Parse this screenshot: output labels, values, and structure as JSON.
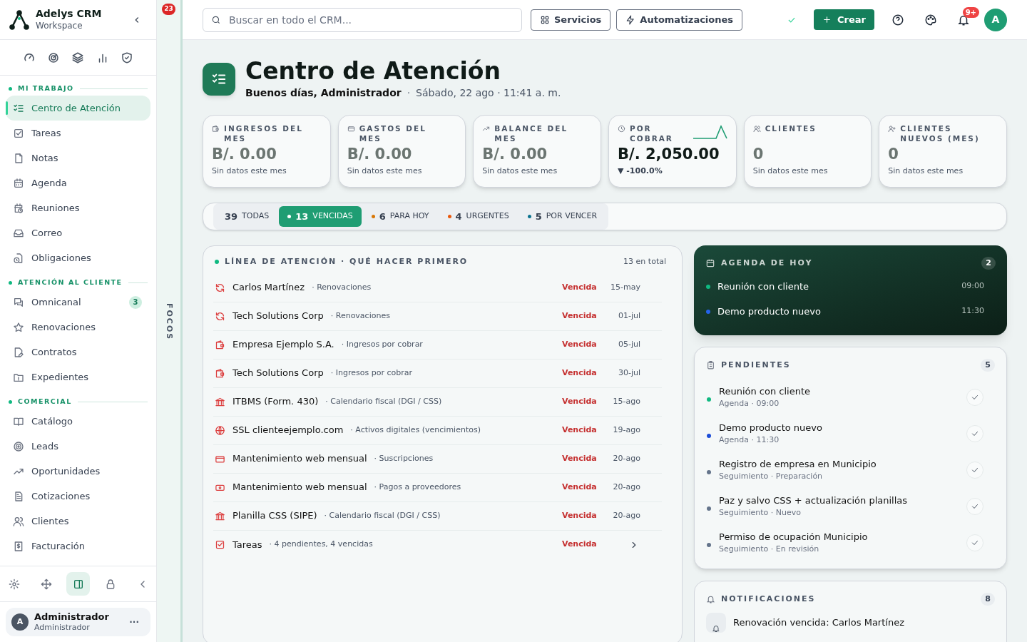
{
  "sidebar": {
    "brand": "Adelys CRM",
    "workspace": "Workspace",
    "sections": [
      {
        "title": "MI TRABAJO",
        "items": [
          {
            "label": "Centro de Atención",
            "selected": true
          },
          {
            "label": "Tareas",
            "selected": false
          },
          {
            "label": "Notas",
            "selected": false
          },
          {
            "label": "Agenda",
            "selected": false
          },
          {
            "label": "Reuniones",
            "selected": false
          },
          {
            "label": "Correo",
            "selected": false
          },
          {
            "label": "Obligaciones",
            "selected": false
          }
        ]
      },
      {
        "title": "ATENCIÓN AL CLIENTE",
        "items": [
          {
            "label": "Omnicanal",
            "selected": false,
            "badge": "3"
          },
          {
            "label": "Renovaciones",
            "selected": false
          },
          {
            "label": "Contratos",
            "selected": false
          },
          {
            "label": "Expedientes",
            "selected": false
          }
        ]
      },
      {
        "title": "COMERCIAL",
        "items": [
          {
            "label": "Catálogo",
            "selected": false
          },
          {
            "label": "Leads",
            "selected": false
          },
          {
            "label": "Oportunidades",
            "selected": false
          },
          {
            "label": "Cotizaciones",
            "selected": false
          },
          {
            "label": "Clientes",
            "selected": false
          },
          {
            "label": "Facturación",
            "selected": false
          }
        ]
      }
    ],
    "tools": [
      {
        "selected": false
      },
      {
        "selected": false
      },
      {
        "selected": true
      },
      {
        "selected": false
      },
      {
        "selected": false
      }
    ],
    "user": {
      "avatar": "A",
      "name": "Administrador",
      "role": "Administrador",
      "more": "···"
    }
  },
  "rail": {
    "badge": "23",
    "label": "FOCOS"
  },
  "topbar": {
    "search": {
      "placeholder": "Buscar en todo el CRM..."
    },
    "buttons": [
      "Servicios",
      "Automatizaciones"
    ],
    "create": "Crear",
    "notifications_badge": "9+",
    "avatar": "A"
  },
  "header": {
    "title": "Centro de Atención",
    "greeting": "Buenos días, Administrador",
    "separator": "·",
    "date": "Sábado, 22 ago · 11:41 a. m."
  },
  "stats": [
    {
      "label": "INGRESOS DEL MES",
      "value": "B/. 0.00",
      "note": "Sin datos este mes",
      "empty": true
    },
    {
      "label": "GASTOS DEL MES",
      "value": "B/. 0.00",
      "note": "Sin datos este mes",
      "empty": true
    },
    {
      "label": "BALANCE DEL MES",
      "value": "B/. 0.00",
      "note": "Sin datos este mes",
      "empty": true
    },
    {
      "label": "POR COBRAR",
      "value": "B/. 2,050.00",
      "trend": "▼ -100.0%",
      "empty": false,
      "sparkline": true
    },
    {
      "label": "CLIENTES",
      "value": "0",
      "note": "Sin datos este mes",
      "empty": true
    },
    {
      "label": "CLIENTES NUEVOS (MES)",
      "value": "0",
      "note": "Sin datos este mes",
      "empty": true
    }
  ],
  "filters": [
    {
      "count": "39",
      "label": "TODAS",
      "selected": false
    },
    {
      "count": "13",
      "label": "VENCIDAS",
      "selected": true,
      "color": "#ffffff"
    },
    {
      "count": "6",
      "label": "PARA HOY",
      "selected": false,
      "color": "#d97706"
    },
    {
      "count": "4",
      "label": "URGENTES",
      "selected": false,
      "color": "#ea580c"
    },
    {
      "count": "5",
      "label": "POR VENCER",
      "selected": false,
      "color": "#0e7490"
    }
  ],
  "focus": {
    "title": "LÍNEA DE ATENCIÓN · QUÉ HACER PRIMERO",
    "total": "13 en total",
    "rows": [
      {
        "kind": "item",
        "title": "Carlos Martínez",
        "category": "· Renovaciones",
        "status": "Vencida",
        "date": "15-may"
      },
      {
        "kind": "item",
        "title": "Tech Solutions Corp",
        "category": "· Renovaciones",
        "status": "Vencida",
        "date": "01-jul"
      },
      {
        "kind": "item",
        "title": "Empresa Ejemplo S.A.",
        "category": "· Ingresos por cobrar",
        "status": "Vencida",
        "date": "05-jul"
      },
      {
        "kind": "item",
        "title": "Tech Solutions Corp",
        "category": "· Ingresos por cobrar",
        "status": "Vencida",
        "date": "30-jul"
      },
      {
        "kind": "item",
        "title": "ITBMS (Form. 430)",
        "category": "· Calendario fiscal (DGI / CSS)",
        "status": "Vencida",
        "date": "15-ago"
      },
      {
        "kind": "item",
        "title": "SSL clienteejemplo.com",
        "category": "· Activos digitales (vencimientos)",
        "status": "Vencida",
        "date": "19-ago"
      },
      {
        "kind": "item",
        "title": "Mantenimiento web mensual",
        "category": "· Suscripciones",
        "status": "Vencida",
        "date": "20-ago"
      },
      {
        "kind": "item",
        "title": "Mantenimiento web mensual",
        "category": "· Pagos a proveedores",
        "status": "Vencida",
        "date": "20-ago"
      },
      {
        "kind": "item",
        "title": "Planilla CSS (SIPE)",
        "category": "· Calendario fiscal (DGI / CSS)",
        "status": "Vencida",
        "date": "20-ago"
      },
      {
        "kind": "group",
        "title": "Tareas",
        "category": "· 4 pendientes, 4 vencidas",
        "status": "Vencida"
      }
    ]
  },
  "agenda": {
    "title": "AGENDA DE HOY",
    "count": "2",
    "items": [
      {
        "title": "Reunión con cliente",
        "time": "09:00",
        "color": "#10b981"
      },
      {
        "title": "Demo producto nuevo",
        "time": "11:30",
        "color": "#2563eb"
      }
    ]
  },
  "pending": {
    "title": "PENDIENTES",
    "count": "5",
    "items": [
      {
        "title": "Reunión con cliente",
        "subtitle": "Agenda · 09:00",
        "color": "#10b981"
      },
      {
        "title": "Demo producto nuevo",
        "subtitle": "Agenda · 11:30",
        "color": "#1d4ed8"
      },
      {
        "title": "Registro de empresa en Municipio",
        "subtitle": "Seguimiento · Preparación",
        "color": "#64748b"
      },
      {
        "title": "Paz y salvo CSS + actualización planillas",
        "subtitle": "Seguimiento · Nuevo",
        "color": "#64748b"
      },
      {
        "title": "Permiso de ocupación Municipio",
        "subtitle": "Seguimiento · En revisión",
        "color": "#64748b"
      }
    ]
  },
  "notifications": {
    "title": "NOTIFICACIONES",
    "count": "8",
    "items": [
      {
        "title": "Renovación vencida: Carlos Martínez"
      }
    ]
  }
}
